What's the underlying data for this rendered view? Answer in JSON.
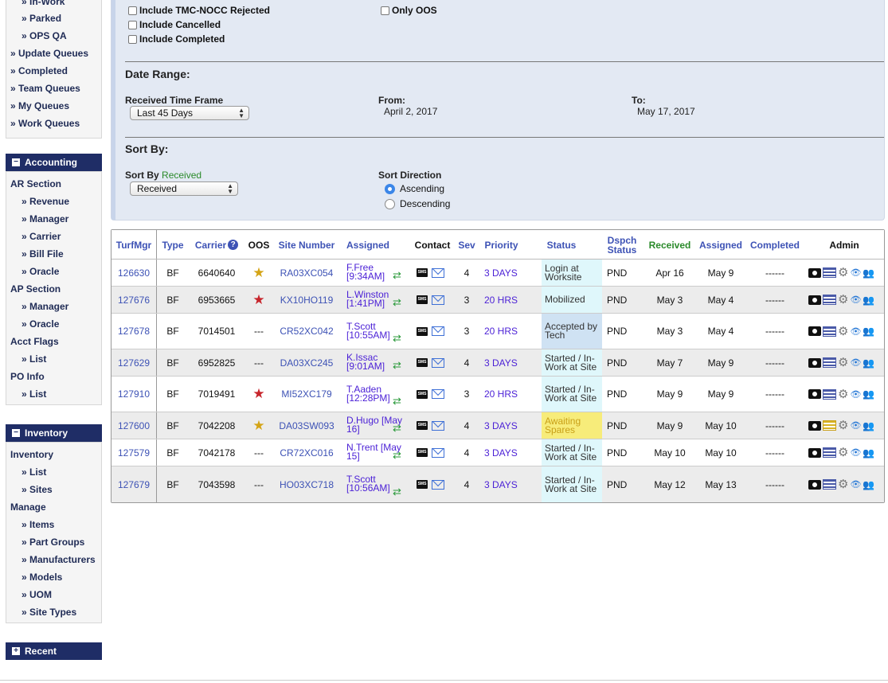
{
  "sidebar": {
    "top_items": [
      {
        "label": "» In-Work",
        "level": 2
      },
      {
        "label": "» Parked",
        "level": 2
      },
      {
        "label": "» OPS QA",
        "level": 2
      },
      {
        "label": "» Update Queues",
        "level": 1
      },
      {
        "label": "» Completed",
        "level": 1
      },
      {
        "label": "» Team Queues",
        "level": 1
      },
      {
        "label": "» My Queues",
        "level": 1
      },
      {
        "label": "» Work Queues",
        "level": 1
      }
    ],
    "accounting": {
      "header": "Accounting",
      "toggle": "−",
      "ar_section": "AR Section",
      "ar_items": [
        "» Revenue",
        "» Manager",
        "» Carrier",
        "» Bill File",
        "» Oracle"
      ],
      "ap_section": "AP Section",
      "ap_items": [
        "» Manager",
        "» Oracle"
      ],
      "acct_flags": "Acct Flags",
      "acct_items": [
        "» List"
      ],
      "po_info": "PO Info",
      "po_items": [
        "» List"
      ]
    },
    "inventory": {
      "header": "Inventory",
      "toggle": "−",
      "inventory_section": "Inventory",
      "inventory_items": [
        "» List",
        "» Sites"
      ],
      "manage_section": "Manage",
      "manage_items": [
        "» Items",
        "» Part Groups",
        "» Manufacturers",
        "» Models",
        "» UOM",
        "» Site Types"
      ]
    },
    "recent": {
      "header": "Recent",
      "toggle": "+"
    }
  },
  "filters": {
    "include_tmc_nocc_rejected": "Include TMC-NOCC Rejected",
    "include_cancelled": "Include Cancelled",
    "include_completed": "Include Completed",
    "only_oos": "Only OOS",
    "date_range_title": "Date Range:",
    "received_time_frame_label": "Received Time Frame",
    "received_time_frame_value": "Last 45 Days",
    "from_label": "From:",
    "from_value": "April 2, 2017",
    "to_label": "To:",
    "to_value": "May 17, 2017",
    "sort_by_title": "Sort By:",
    "sort_by_label": "Sort By",
    "sort_by_field": "Received",
    "sort_by_value": "Received",
    "sort_direction_label": "Sort Direction",
    "ascending": "Ascending",
    "descending": "Descending",
    "direction_selected": "Ascending"
  },
  "table": {
    "headers": {
      "turfmgr": "TurfMgr",
      "type": "Type",
      "carrier": "Carrier",
      "oos": "OOS",
      "site_number": "Site Number",
      "assigned": "Assigned",
      "contact": "Contact",
      "sev": "Sev",
      "priority": "Priority",
      "status": "Status",
      "dspch_status_1": "Dspch",
      "dspch_status_2": "Status",
      "received": "Received",
      "assigned_date": "Assigned",
      "completed": "Completed",
      "admin": "Admin"
    },
    "rows": [
      {
        "id": "126630",
        "type": "BF",
        "carrier": "6640640",
        "oos": "gold-star",
        "oos_text": "",
        "site": "RA03XC054",
        "assigned_1": "F.Free",
        "assigned_2": "[9:34AM]",
        "sev": "4",
        "priority": "3 DAYS",
        "status_1": "Login at",
        "status_2": "Worksite",
        "status_color": "#dff7fb",
        "dspch": "PND",
        "received": "Apr 16",
        "assigned_date": "May 9",
        "completed": "------",
        "list_icon": "blue",
        "people_icon": "green"
      },
      {
        "id": "127676",
        "type": "BF",
        "carrier": "6953665",
        "oos": "red-star",
        "oos_text": "",
        "site": "KX10HO119",
        "assigned_1": "L.Winston",
        "assigned_2": "[1:41PM]",
        "sev": "3",
        "priority": "20 HRS",
        "status_1": "Mobilized",
        "status_2": "",
        "status_color": "#dff7fb",
        "dspch": "PND",
        "received": "May 3",
        "assigned_date": "May 4",
        "completed": "------",
        "list_icon": "blue",
        "people_icon": "black"
      },
      {
        "id": "127678",
        "type": "BF",
        "carrier": "7014501",
        "oos": "none",
        "oos_text": "---",
        "site": "CR52XC042",
        "assigned_1": "T.Scott",
        "assigned_2": "[10:55AM]",
        "sev": "3",
        "priority": "20 HRS",
        "status_1": "Accepted by",
        "status_2": "Tech",
        "status_color": "#cfe2f3",
        "dspch": "PND",
        "received": "May 3",
        "assigned_date": "May 4",
        "completed": "------",
        "list_icon": "blue",
        "people_icon": "green"
      },
      {
        "id": "127629",
        "type": "BF",
        "carrier": "6952825",
        "oos": "none",
        "oos_text": "---",
        "site": "DA03XC245",
        "assigned_1": "K.Issac",
        "assigned_2": "[9:01AM]",
        "sev": "4",
        "priority": "3 DAYS",
        "status_1": "Started / In-",
        "status_2": "Work at Site",
        "status_color": "#dff7fb",
        "dspch": "PND",
        "received": "May 7",
        "assigned_date": "May 9",
        "completed": "------",
        "list_icon": "blue",
        "people_icon": "black"
      },
      {
        "id": "127910",
        "type": "BF",
        "carrier": "7019491",
        "oos": "red-star",
        "oos_text": "",
        "site": "MI52XC179",
        "assigned_1": "T.Aaden",
        "assigned_2": "[12:28PM]",
        "sev": "3",
        "priority": "20 HRS",
        "status_1": "Started / In-",
        "status_2": "Work at Site",
        "status_color": "#dff7fb",
        "dspch": "PND",
        "received": "May 9",
        "assigned_date": "May 9",
        "completed": "------",
        "list_icon": "blue",
        "people_icon": "black"
      },
      {
        "id": "127600",
        "type": "BF",
        "carrier": "7042208",
        "oos": "gold-star",
        "oos_text": "",
        "site": "DA03SW093",
        "assigned_1": "D.Hugo [May",
        "assigned_2": "16]",
        "sev": "4",
        "priority": "3 DAYS",
        "status_1": "Awaiting",
        "status_2": "Spares",
        "status_color": "#f7ec7a",
        "dspch": "PND",
        "received": "May 9",
        "assigned_date": "May 10",
        "completed": "------",
        "list_icon": "gold",
        "people_icon": "black"
      },
      {
        "id": "127579",
        "type": "BF",
        "carrier": "7042178",
        "oos": "none",
        "oos_text": "---",
        "site": "CR72XC016",
        "assigned_1": "N.Trent [May",
        "assigned_2": "15]",
        "sev": "4",
        "priority": "3 DAYS",
        "status_1": "Started / In-",
        "status_2": "Work at Site",
        "status_color": "#dff7fb",
        "dspch": "PND",
        "received": "May 10",
        "assigned_date": "May 10",
        "completed": "------",
        "list_icon": "blue",
        "people_icon": "black"
      },
      {
        "id": "127679",
        "type": "BF",
        "carrier": "7043598",
        "oos": "none",
        "oos_text": "---",
        "site": "HO03XC718",
        "assigned_1": "T.Scott",
        "assigned_2": "[10:56AM]",
        "sev": "4",
        "priority": "3 DAYS",
        "status_1": "Started / In-",
        "status_2": "Work at Site",
        "status_color": "#dff7fb",
        "dspch": "PND",
        "received": "May 12",
        "assigned_date": "May 13",
        "completed": "------",
        "list_icon": "blue",
        "people_icon": "green"
      }
    ]
  },
  "icons": {
    "help": "?",
    "star": "★",
    "swap": "⇄",
    "sms": "SMS",
    "gear": "⚙",
    "eye": "👁",
    "people": "👥",
    "select_arrows": "▲▼"
  },
  "colors": {
    "accent_navy": "#1f2d66",
    "link_blue": "#3d52b5",
    "purple_link": "#4a1fd6",
    "green_header": "#2a8a2a",
    "panel_bg": "#e3e9f3",
    "awaiting_yellow": "#f7ec7a",
    "status_cyan": "#dff7fb"
  }
}
